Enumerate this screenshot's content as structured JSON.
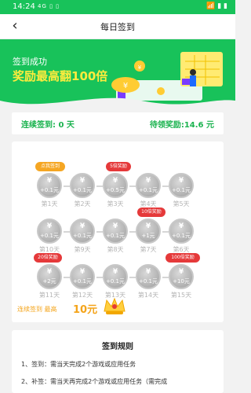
{
  "status": {
    "time": "14:24",
    "left_indicators": "4G ▯ ▯",
    "right_indicators": "📶 ▮ ▮"
  },
  "nav": {
    "title": "每日签到"
  },
  "banner": {
    "title": "签到成功",
    "subtitle": "奖励最高翻100倍"
  },
  "summary": {
    "streak_text": "连续签到: 0 天",
    "pending_text": "待领奖励:14.6 元"
  },
  "rows": [
    {
      "cells": [
        {
          "amount": "+0.1元",
          "day": "第1天",
          "tag": "点我签到",
          "tag_color": "#f5a623"
        },
        {
          "amount": "+0.1元",
          "day": "第2天"
        },
        {
          "amount": "+0.5元",
          "day": "第3天",
          "tag": "5倍奖励",
          "tag_color": "#e5393a"
        },
        {
          "amount": "+0.1元",
          "day": "第4天"
        },
        {
          "amount": "+0.1元",
          "day": "第5天"
        }
      ]
    },
    {
      "cells": [
        {
          "amount": "+0.1元",
          "day": "第10天"
        },
        {
          "amount": "+0.1元",
          "day": "第9天"
        },
        {
          "amount": "+0.1元",
          "day": "第8天"
        },
        {
          "amount": "+1元",
          "day": "第7天",
          "tag": "10倍奖励",
          "tag_color": "#e5393a"
        },
        {
          "amount": "+0.1元",
          "day": "第6天"
        }
      ]
    },
    {
      "cells": [
        {
          "amount": "+2元",
          "day": "第11天",
          "tag": "20倍奖励",
          "tag_color": "#e5393a"
        },
        {
          "amount": "+0.1元",
          "day": "第12天"
        },
        {
          "amount": "+0.1元",
          "day": "第13天"
        },
        {
          "amount": "+0.1元",
          "day": "第14天"
        },
        {
          "amount": "+10元",
          "day": "第15天",
          "tag": "100倍奖励",
          "tag_color": "#e5393a"
        }
      ]
    }
  ],
  "streak": {
    "label": "连续签到 最高",
    "value": "10元"
  },
  "rules": {
    "heading": "签到规则",
    "items": [
      "1、签到：需当天完成2个游戏或应用任务",
      "2、补签：需当天再完成2个游戏或应用任务（需完成"
    ]
  },
  "colors": {
    "green": "#18c25a",
    "yellow": "#ffec3d",
    "orange": "#f4a41a",
    "red": "#e5393a"
  },
  "icons": {
    "back": "back-arrow-icon",
    "coin": "coin-icon",
    "crown": "crown-icon"
  }
}
